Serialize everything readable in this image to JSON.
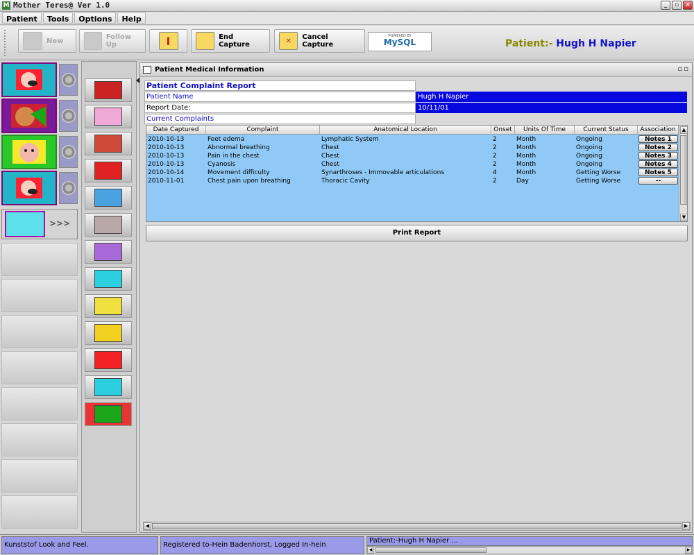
{
  "window": {
    "title": "Mother Teres@ Ver 1.0",
    "minimize": "_",
    "restore": "▫",
    "close": "×"
  },
  "menubar": {
    "items": [
      "Patient",
      "Tools",
      "Options",
      "Help"
    ]
  },
  "toolbar": {
    "new_label": "New",
    "follow_up_label": "Follow Up",
    "end_capture_label": "End Capture",
    "cancel_capture_label": "Cancel Capture",
    "mysql_powered": "POWERED BY",
    "mysql_text": "MySQL",
    "patient_prefix": "Patient:- ",
    "patient_name": "Hugh H Napier"
  },
  "left_nav": {
    "more_label": ">>>"
  },
  "panel": {
    "title": "Patient Medical Information",
    "controls": "▫▫",
    "report_title": "Patient Complaint Report",
    "patient_name_label": "Patient Name",
    "patient_name_value": "Hugh H Napier",
    "report_date_label": "Report Date:",
    "report_date_value": "10/11/01",
    "current_complaints_label": "Current Complaints",
    "print_label": "Print Report"
  },
  "table": {
    "headers": [
      "Date Captured",
      "Complaint",
      "Anatomical Location",
      "Onset",
      "Units Of Time",
      "Current Status",
      "Association"
    ],
    "rows": [
      {
        "date": "2010-10-13",
        "complaint": "Feet edema",
        "location": "Lymphatic System",
        "onset": "2",
        "units": "Month",
        "status": "Ongoing",
        "assoc": "Notes  1"
      },
      {
        "date": "2010-10-13",
        "complaint": "Abnormal breathing",
        "location": "Chest",
        "onset": "2",
        "units": "Month",
        "status": "Ongoing",
        "assoc": "Notes  2"
      },
      {
        "date": "2010-10-13",
        "complaint": "Pain in the chest",
        "location": "Chest",
        "onset": "2",
        "units": "Month",
        "status": "Ongoing",
        "assoc": "Notes  3"
      },
      {
        "date": "2010-10-13",
        "complaint": "Cyanosis",
        "location": "Chest",
        "onset": "2",
        "units": "Month",
        "status": "Ongoing",
        "assoc": "Notes  4"
      },
      {
        "date": "2010-10-14",
        "complaint": "Movement difficulty",
        "location": "Synarthroses - Immovable articulations",
        "onset": "4",
        "units": "Month",
        "status": "Getting Worse",
        "assoc": "Notes  5"
      },
      {
        "date": "2010-11-01",
        "complaint": "Chest pain upon breathing",
        "location": "Thoracic Cavity",
        "onset": "2",
        "units": "Day",
        "status": "Getting Worse",
        "assoc": "--"
      }
    ]
  },
  "statusbar": {
    "look_and_feel": "Kunststof Look and Feel.",
    "registration": "Registered to-Hein Badenhorst, Logged In-hein",
    "patient": "Patient:-Hugh H Napier ..."
  },
  "colors": {
    "selection": "#0707e0",
    "table_bg": "#90c9f5",
    "status_bg": "#9a9ae8",
    "patient_label": "#8a8800",
    "patient_name": "#1212c8"
  }
}
